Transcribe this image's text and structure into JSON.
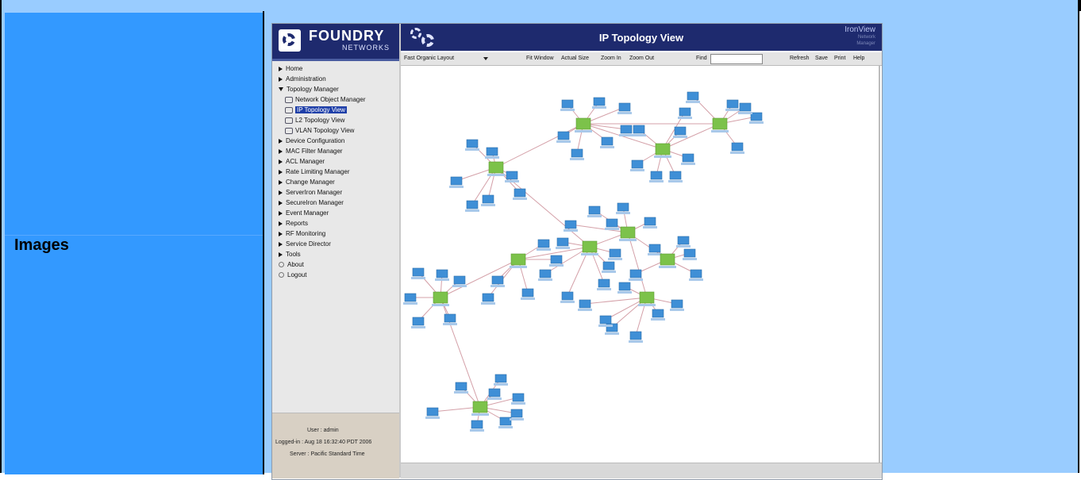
{
  "row_label": "Images",
  "screenshot": {
    "brand": {
      "name": "FOUNDRY",
      "sub": "NETWORKS"
    },
    "menu": [
      {
        "label": "Home",
        "icon": "triangle-right"
      },
      {
        "label": "Administration",
        "icon": "triangle-right"
      },
      {
        "label": "Topology Manager",
        "icon": "triangle-down"
      },
      {
        "label": "Network Object Manager",
        "icon": "topology",
        "sub": true
      },
      {
        "label": "IP Topology View",
        "icon": "topology",
        "sub": true,
        "selected": true
      },
      {
        "label": "L2 Topology View",
        "icon": "topology",
        "sub": true
      },
      {
        "label": "VLAN Topology View",
        "icon": "topology",
        "sub": true
      },
      {
        "label": "Device Configuration",
        "icon": "triangle-right"
      },
      {
        "label": "MAC Filter Manager",
        "icon": "triangle-right"
      },
      {
        "label": "ACL Manager",
        "icon": "triangle-right"
      },
      {
        "label": "Rate Limiting Manager",
        "icon": "triangle-right"
      },
      {
        "label": "Change Manager",
        "icon": "triangle-right"
      },
      {
        "label": "ServerIron Manager",
        "icon": "triangle-right"
      },
      {
        "label": "SecureIron Manager",
        "icon": "triangle-right"
      },
      {
        "label": "Event Manager",
        "icon": "triangle-right"
      },
      {
        "label": "Reports",
        "icon": "triangle-right"
      },
      {
        "label": "RF Monitoring",
        "icon": "triangle-right"
      },
      {
        "label": "Service Director",
        "icon": "triangle-right"
      },
      {
        "label": "Tools",
        "icon": "triangle-right"
      },
      {
        "label": "About",
        "icon": "circle"
      },
      {
        "label": "Logout",
        "icon": "circle"
      }
    ],
    "user": {
      "user_line": "User : admin",
      "logged_line": "Logged-in : Aug 18 16:32:40 PDT 2006",
      "server_line": "Server : Pacific Standard Time"
    },
    "title": "IP Topology View",
    "product": {
      "name": "IronView",
      "line1": "Network",
      "line2": "Manager"
    },
    "toolbar": {
      "layout_select": "Fast Organic Layout",
      "fit_window": "Fit Window",
      "actual_size": "Actual Size",
      "zoom_in": "Zoom In",
      "zoom_out": "Zoom Out",
      "find_label": "Find",
      "find_value": "",
      "refresh": "Refresh",
      "save": "Save",
      "print": "Print",
      "help": "Help"
    },
    "colors": {
      "brand_bg": "#1e2a6e",
      "router_node": "#7cc24a",
      "host_node": "#3f8fd6",
      "edge": "#d4a0a8"
    }
  }
}
